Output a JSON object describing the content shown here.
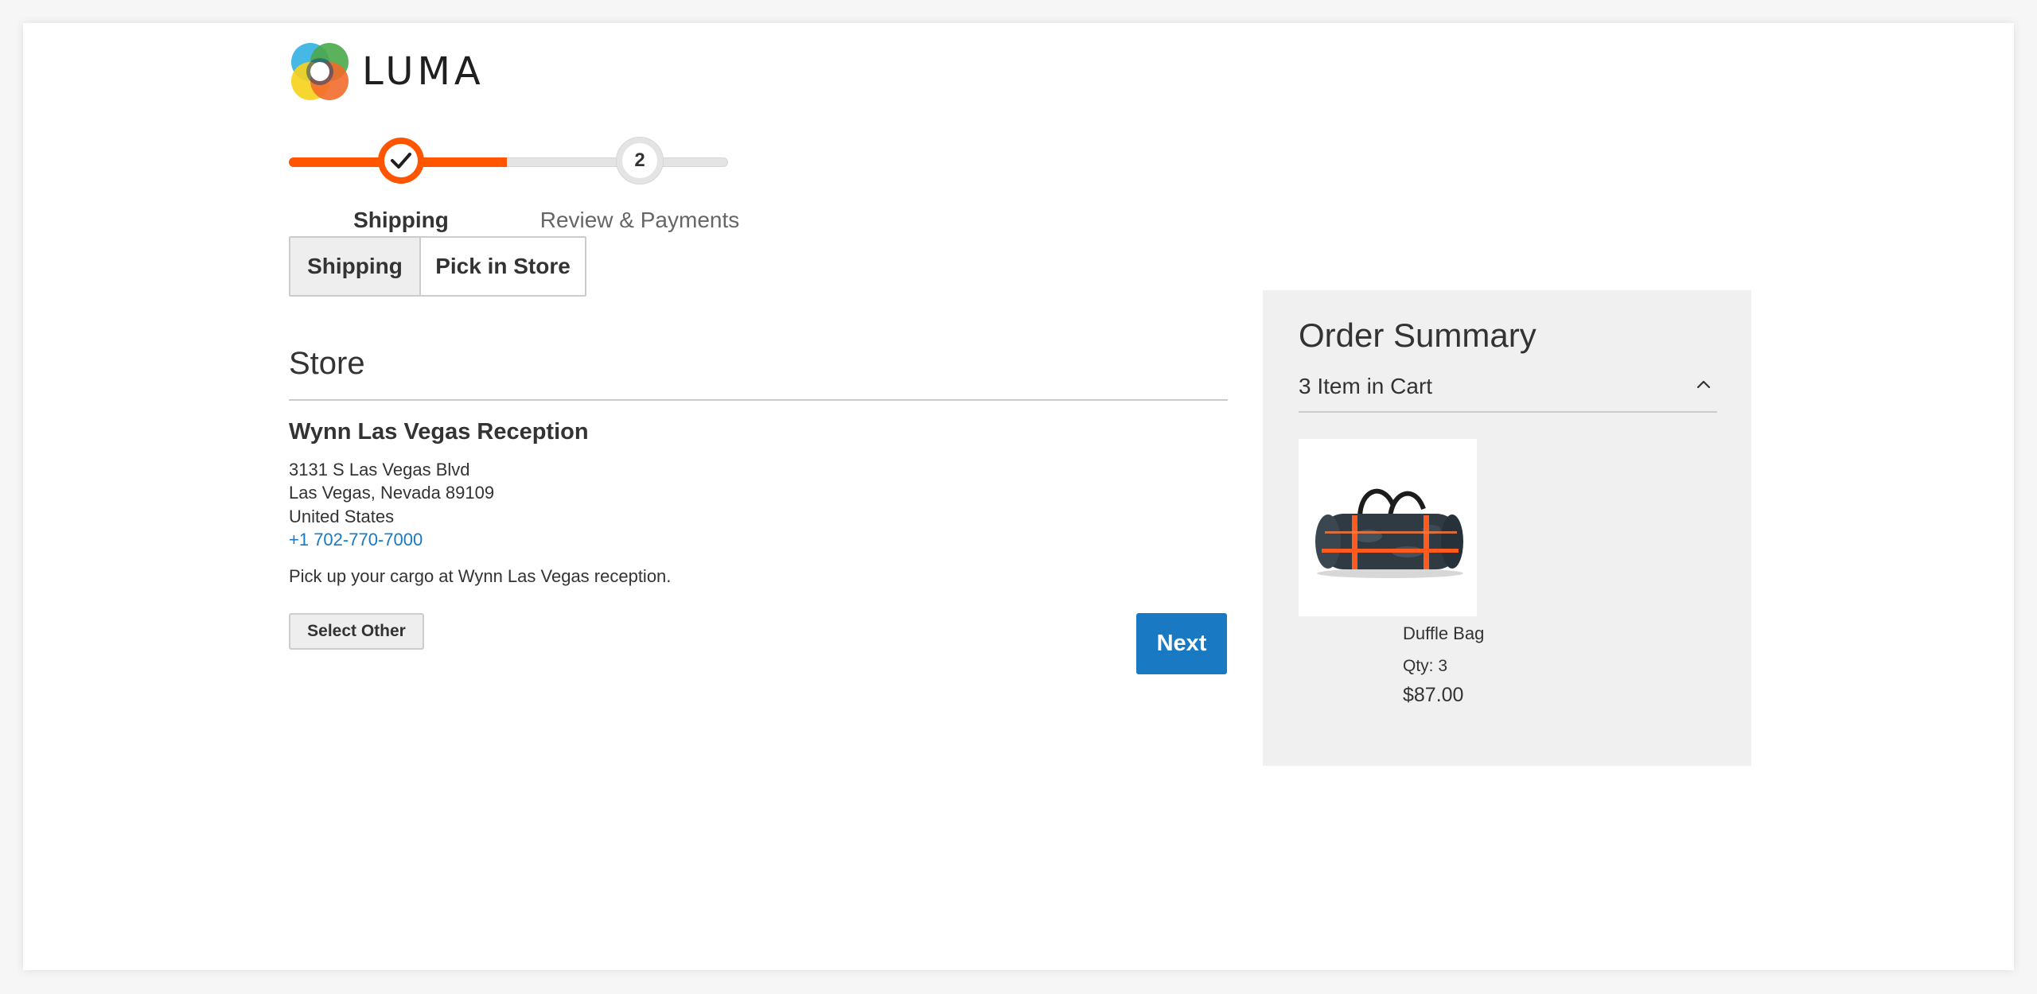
{
  "brand": {
    "name": "LUMA",
    "colors": {
      "accent": "#ff5501",
      "primary_button": "#1979c3",
      "link": "#1979c3"
    }
  },
  "progress": {
    "steps": [
      {
        "label": "Shipping",
        "status": "complete",
        "icon": "checkmark-icon"
      },
      {
        "label": "Review & Payments",
        "status": "pending",
        "number": "2"
      }
    ]
  },
  "delivery_tabs": {
    "shipping": "Shipping",
    "pick_in_store": "Pick in Store",
    "active": "Shipping"
  },
  "store": {
    "heading": "Store",
    "name": "Wynn Las Vegas Reception",
    "address_line1": "3131 S Las Vegas Blvd",
    "address_line2": "Las Vegas, Nevada 89109",
    "country": "United States",
    "phone": "+1 702-770-7000",
    "note": "Pick up your cargo at Wynn Las Vegas reception.",
    "select_other_label": "Select Other"
  },
  "actions": {
    "next_label": "Next"
  },
  "order_summary": {
    "title": "Order Summary",
    "cart_count_label": "3 Item in Cart",
    "toggle_icon": "chevron-up-icon",
    "items": [
      {
        "name": "Duffle Bag",
        "qty_label": "Qty: 3",
        "price": "$87.00",
        "image_icon": "duffle-bag-image"
      }
    ]
  }
}
